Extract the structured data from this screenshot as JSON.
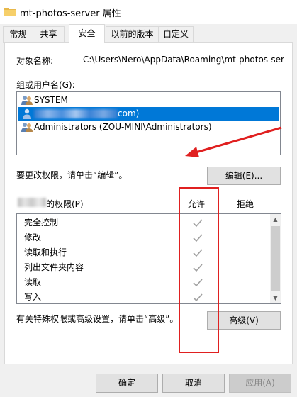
{
  "window": {
    "title": "mt-photos-server 属性",
    "icon": "folder-icon"
  },
  "tabs": [
    {
      "label": "常规",
      "active": false
    },
    {
      "label": "共享",
      "active": false
    },
    {
      "label": "安全",
      "active": true
    },
    {
      "label": "以前的版本",
      "active": false
    },
    {
      "label": "自定义",
      "active": false
    }
  ],
  "security": {
    "object_name_label": "对象名称:",
    "object_name_value": "C:\\Users\\Nero\\AppData\\Roaming\\mt-photos-ser",
    "groups_label": "组或用户名(G):",
    "users": [
      {
        "name": "SYSTEM",
        "selected": false,
        "icon": "user-group-icon"
      },
      {
        "name": "com)",
        "selected": true,
        "icon": "user-icon"
      },
      {
        "name": "Administrators (ZOU-MINI\\Administrators)",
        "selected": false,
        "icon": "user-group-icon"
      }
    ],
    "change_hint": "要更改权限，请单击“编辑”。",
    "edit_button": "编辑(E)...",
    "permissions_label": "的权限(P)",
    "allow_header": "允许",
    "deny_header": "拒绝",
    "permissions": [
      {
        "name": "完全控制",
        "allow": true,
        "deny": false
      },
      {
        "name": "修改",
        "allow": true,
        "deny": false
      },
      {
        "name": "读取和执行",
        "allow": true,
        "deny": false
      },
      {
        "name": "列出文件夹内容",
        "allow": true,
        "deny": false
      },
      {
        "name": "读取",
        "allow": true,
        "deny": false
      },
      {
        "name": "写入",
        "allow": true,
        "deny": false
      }
    ],
    "advanced_hint": "有关特殊权限或高级设置，请单击“高级”。",
    "advanced_button": "高级(V)"
  },
  "footer": {
    "ok": "确定",
    "cancel": "取消",
    "apply": "应用(A)"
  },
  "colors": {
    "selection": "#0078d7",
    "annotation": "#e02020",
    "check": "#a0a0a0"
  }
}
